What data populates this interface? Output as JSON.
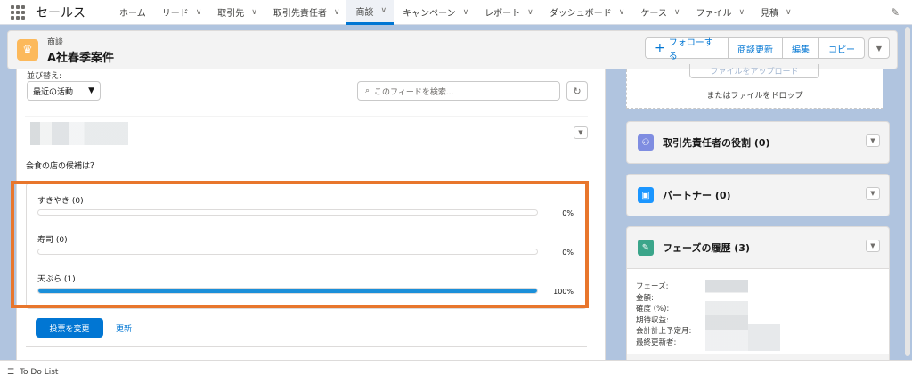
{
  "app": {
    "name": "セールス"
  },
  "nav": [
    {
      "label": "ホーム",
      "chevron": false
    },
    {
      "label": "リード",
      "chevron": true
    },
    {
      "label": "取引先",
      "chevron": true
    },
    {
      "label": "取引先責任者",
      "chevron": true
    },
    {
      "label": "商談",
      "chevron": true,
      "active": true
    },
    {
      "label": "キャンペーン",
      "chevron": true
    },
    {
      "label": "レポート",
      "chevron": true
    },
    {
      "label": "ダッシュボード",
      "chevron": true
    },
    {
      "label": "ケース",
      "chevron": true
    },
    {
      "label": "ファイル",
      "chevron": true
    },
    {
      "label": "見積",
      "chevron": true
    }
  ],
  "record": {
    "object_label": "商談",
    "name": "A社春季案件",
    "buttons": {
      "follow": "フォローする",
      "update": "商談更新",
      "edit": "編集",
      "copy": "コピー"
    }
  },
  "feed": {
    "sort_label": "並び替え:",
    "sort_value": "最近の活動",
    "search_placeholder": "このフィードを検索...",
    "post": {
      "question": "会食の店の候補は？",
      "options": [
        {
          "label": "すきやき (0)",
          "percent": 0,
          "percent_text": "0%"
        },
        {
          "label": "寿司 (0)",
          "percent": 0,
          "percent_text": "0%"
        },
        {
          "label": "天ぷら (1)",
          "percent": 100,
          "percent_text": "100%"
        }
      ],
      "vote_button": "投票を変更",
      "refresh_link": "更新"
    }
  },
  "right": {
    "upload_button": "ファイルをアップロード",
    "drop_text": "またはファイルをドロップ",
    "cards": {
      "contact_roles": "取引先責任者の役割 (0)",
      "partners": "パートナー (0)",
      "phase_history": "フェーズの履歴 (3)"
    },
    "phase_fields": [
      "フェーズ:",
      "金額:",
      "確度 (%):",
      "期待収益:",
      "会計計上予定月:",
      "最終更新者:"
    ]
  },
  "utility": {
    "todo": "To Do List"
  },
  "colors": {
    "brand": "#0176d3",
    "highlight": "#e8762c",
    "record_icon": "#fcb95b"
  }
}
